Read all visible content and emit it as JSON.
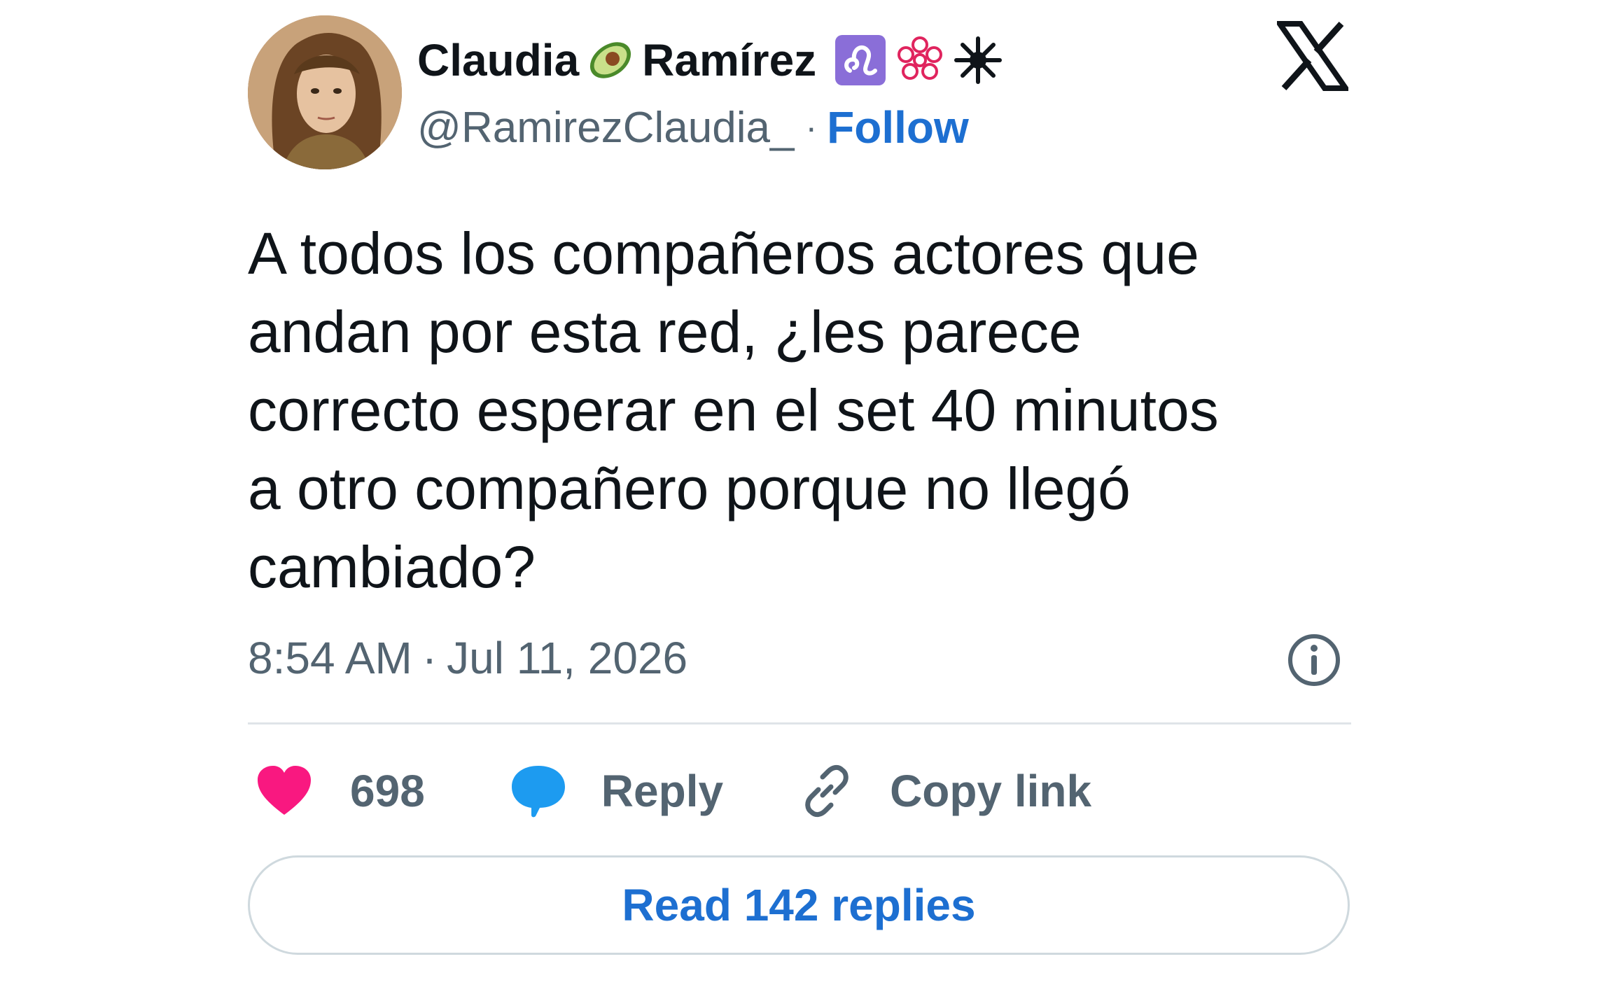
{
  "author": {
    "first_name": "Claudia",
    "last_name": "Ramírez",
    "handle": "@RamirezClaudia_",
    "separator": "·",
    "follow_label": "Follow"
  },
  "name_emojis": [
    "avocado-icon",
    "leo-zodiac-icon",
    "flower-outline-icon",
    "black-star-icon"
  ],
  "tweet": {
    "text": "A todos los compañeros actores que\nandan por esta red, ¿les parece\ncorrecto esperar en el set 40 minutos\na otro compañero porque no llegó\ncambiado?",
    "time": "8:54 AM",
    "separator": "·",
    "date": "Jul 11, 2026"
  },
  "actions": {
    "like_count": "698",
    "reply_label": "Reply",
    "copy_link_label": "Copy link"
  },
  "read_replies_label": "Read 142 replies",
  "colors": {
    "link_blue": "#1d6fd1",
    "heart_pink": "#f91880",
    "reply_bubble_blue": "#1d9bf0",
    "muted_gray": "#536471",
    "text_black": "#0f1419"
  }
}
